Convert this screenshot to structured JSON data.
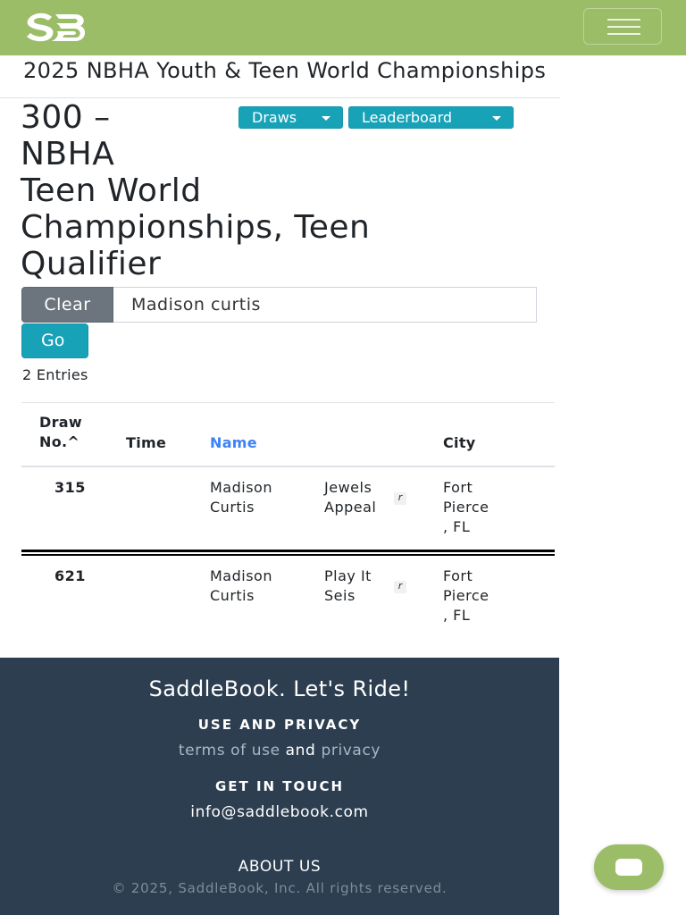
{
  "brand": {
    "logo_icon": "saddlebook-sb-logo",
    "color": "#9bbd67"
  },
  "navbar": {
    "menu_icon": "hamburger-menu-icon"
  },
  "event": {
    "title": "2025 NBHA Youth & Teen World Championships"
  },
  "class": {
    "title_lines": [
      "300 –",
      "NBHA",
      "Teen World",
      "Championships, Teen",
      "Qualifier"
    ]
  },
  "dropdowns": {
    "draws_label": "Draws",
    "leaderboard_label": "Leaderboard"
  },
  "search": {
    "clear_label": "Clear",
    "value": "Madison curtis",
    "go_label": "Go"
  },
  "results": {
    "count_text": "2 Entries",
    "headers": {
      "draw_no_line1": "Draw",
      "draw_no_line2": "No.^",
      "time": "Time",
      "name": "Name",
      "city": "City"
    },
    "rows": [
      {
        "draw_no": "315",
        "time": "",
        "rider_line1": "Madison",
        "rider_line2": "Curtis",
        "horse_line1": "Jewels",
        "horse_line2": "Appeal",
        "reg_mark": "r",
        "city_line1": "Fort",
        "city_line2": "Pierce",
        "city_line3": ", FL"
      },
      {
        "draw_no": "621",
        "time": "",
        "rider_line1": "Madison",
        "rider_line2": "Curtis",
        "horse_line1": "Play It",
        "horse_line2": "Seis",
        "reg_mark": "r",
        "city_line1": "Fort",
        "city_line2": "Pierce",
        "city_line3": ", FL"
      }
    ]
  },
  "footer": {
    "tagline": "SaddleBook. Let's Ride!",
    "use_privacy_heading": "USE AND PRIVACY",
    "terms_link": "terms of use",
    "and_text": "and",
    "privacy_link": "privacy",
    "contact_heading": "GET IN TOUCH",
    "email": "info@saddlebook.com",
    "about_link": "ABOUT US",
    "copyright": "© 2025, SaddleBook, Inc. All rights reserved."
  },
  "chat": {
    "icon": "chat-bubble-icon"
  },
  "colors": {
    "navbar": "#9bbd67",
    "primary_button": "#17a2b8",
    "secondary_button": "#6c757d",
    "footer": "#2c3e50",
    "link": "#3b82f6"
  }
}
